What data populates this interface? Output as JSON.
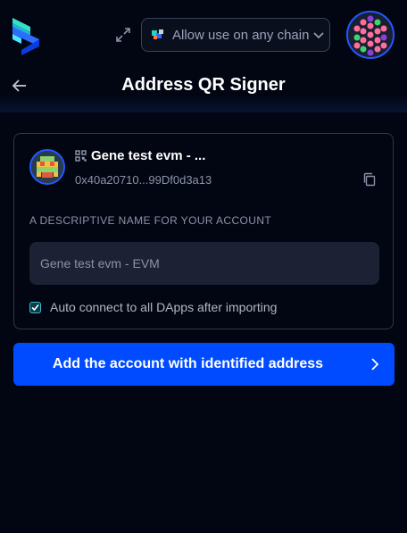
{
  "topbar": {
    "chain_selector_label": "Allow use on any chain",
    "icons": {
      "logo": "subwallet-logo-icon",
      "expand": "expand-icon",
      "chain": "chain-network-icon",
      "chevron": "chevron-down-icon",
      "account": "account-avatar-icon"
    }
  },
  "header": {
    "title": "Address QR Signer",
    "back_icon": "arrow-left-icon"
  },
  "account": {
    "name": "Gene test evm - ...",
    "address": "0x40a20710...99Df0d3a13",
    "qr_icon": "qr-code-icon",
    "copy_icon": "copy-icon"
  },
  "form": {
    "name_label": "A DESCRIPTIVE NAME FOR YOUR ACCOUNT",
    "name_value": "Gene test evm - EVM",
    "auto_connect_label": "Auto connect to all DApps after importing",
    "auto_connect_checked": true
  },
  "action": {
    "button_label": "Add the account with identified address",
    "chevron_icon": "chevron-right-icon"
  },
  "colors": {
    "background": "#020612",
    "accent": "#004bff",
    "card_border": "#2f3648",
    "input_bg": "#1c2234",
    "checkbox": "#3fb6c9"
  }
}
